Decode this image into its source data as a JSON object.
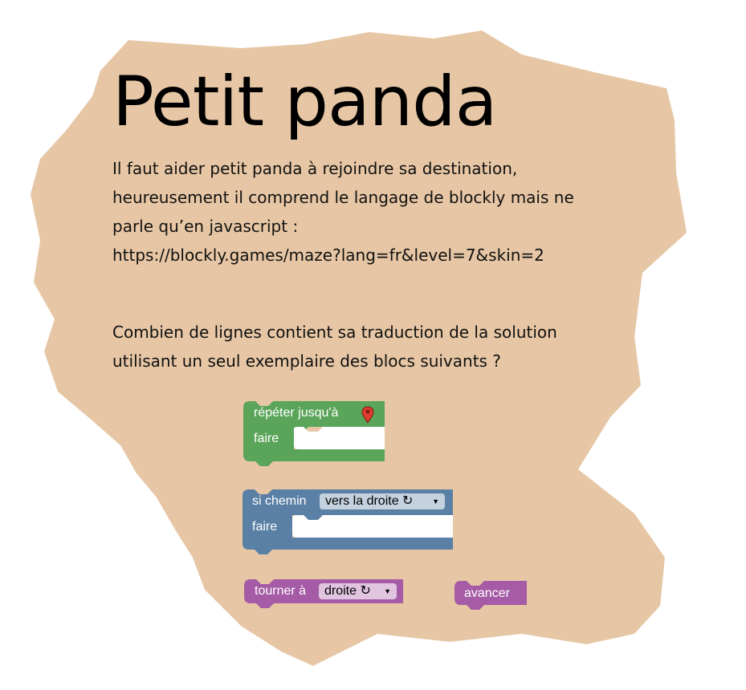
{
  "title": "Petit panda",
  "intro_lines": [
    "Il faut aider petit panda à rejoindre sa destination,",
    "heureusement il comprend le langage de blockly mais ne",
    "parle qu’en javascript :",
    "https://blockly.games/maze?lang=fr&level=7&skin=2"
  ],
  "question_lines": [
    "Combien de lignes contient sa traduction de la solution",
    "utilisant un seul exemplaire des blocs suivants ?"
  ],
  "blocks": {
    "repeat": {
      "label": "répéter jusqu'à",
      "do_label": "faire",
      "icon": "map-marker-icon",
      "color": "#5ba55b"
    },
    "if_path": {
      "label": "si chemin",
      "dropdown": "vers la droite ↻",
      "do_label": "faire",
      "color": "#5b80a5"
    },
    "turn": {
      "label": "tourner à",
      "dropdown": "droite ↻",
      "color": "#a55ba5"
    },
    "move": {
      "label": "avancer",
      "color": "#a55ba5"
    }
  },
  "colors": {
    "paper": "#e6c6a4",
    "background": "#ffffff"
  }
}
